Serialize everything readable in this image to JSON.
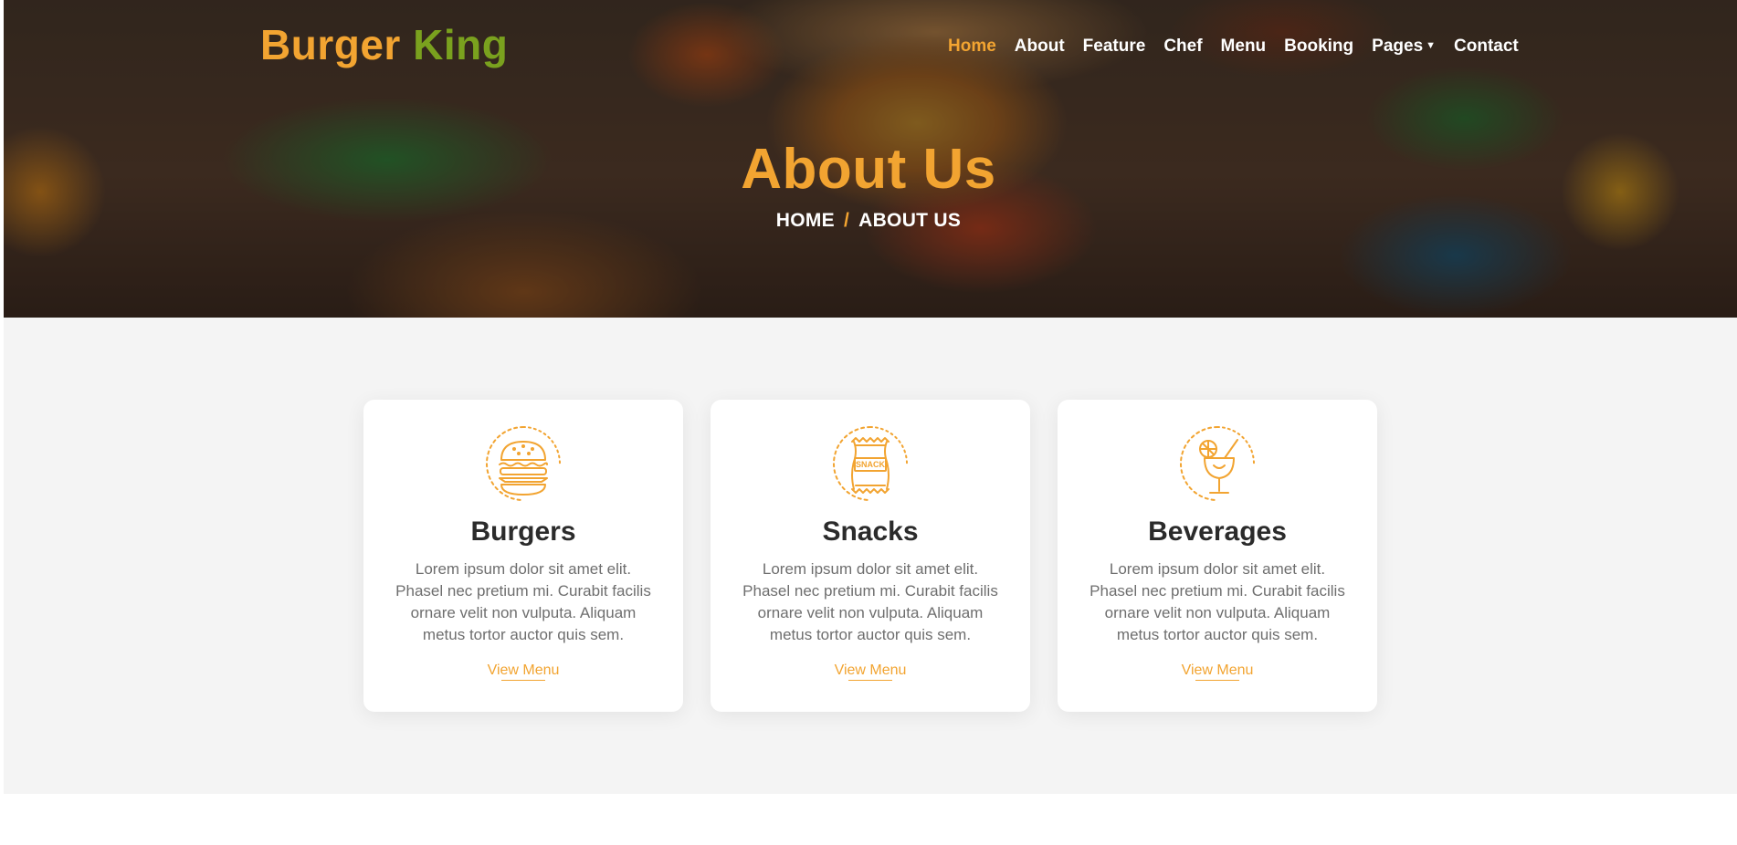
{
  "brand": {
    "part1": "Burger",
    "part2": "King"
  },
  "nav": {
    "items": [
      {
        "label": "Home",
        "active": true
      },
      {
        "label": "About"
      },
      {
        "label": "Feature"
      },
      {
        "label": "Chef"
      },
      {
        "label": "Menu"
      },
      {
        "label": "Booking"
      },
      {
        "label": "Pages",
        "dropdown": true
      },
      {
        "label": "Contact"
      }
    ]
  },
  "hero": {
    "title": "About Us",
    "breadcrumb": {
      "home": "HOME",
      "separator": "/",
      "current": "ABOUT US"
    }
  },
  "cards": [
    {
      "icon": "burger-icon",
      "title": "Burgers",
      "text": "Lorem ipsum dolor sit amet elit. Phasel nec pretium mi. Curabit facilis ornare velit non vulputa. Aliquam metus tortor auctor quis sem.",
      "link": "View Menu"
    },
    {
      "icon": "snack-icon",
      "icon_text": "SNACK",
      "title": "Snacks",
      "text": "Lorem ipsum dolor sit amet elit. Phasel nec pretium mi. Curabit facilis ornare velit non vulputa. Aliquam metus tortor auctor quis sem.",
      "link": "View Menu"
    },
    {
      "icon": "beverage-icon",
      "title": "Beverages",
      "text": "Lorem ipsum dolor sit amet elit. Phasel nec pretium mi. Curabit facilis ornare velit non vulputa. Aliquam metus tortor auctor quis sem.",
      "link": "View Menu"
    }
  ],
  "colors": {
    "accent": "#f2a431",
    "brand_green": "#7aa11e",
    "section_bg": "#f4f4f4",
    "heading": "#2b2b2b",
    "body_text": "#6e6e6e"
  }
}
